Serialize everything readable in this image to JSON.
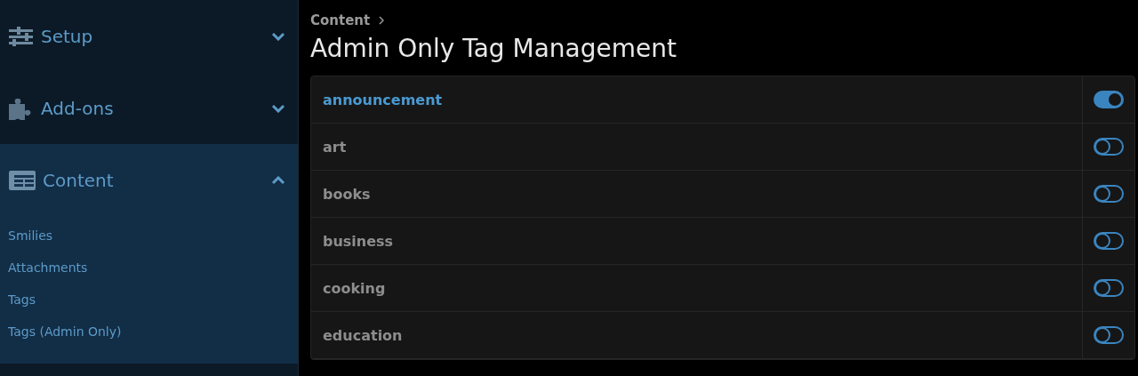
{
  "sidebar": {
    "sections": [
      {
        "label": "Setup",
        "expanded": false
      },
      {
        "label": "Add-ons",
        "expanded": false
      },
      {
        "label": "Content",
        "expanded": true,
        "items": [
          "Smilies",
          "Attachments",
          "Tags",
          "Tags (Admin Only)"
        ]
      }
    ]
  },
  "breadcrumb": [
    "Content"
  ],
  "title": "Admin Only Tag Management",
  "tags": [
    {
      "name": "announcement",
      "on": true
    },
    {
      "name": "art",
      "on": false
    },
    {
      "name": "books",
      "on": false
    },
    {
      "name": "business",
      "on": false
    },
    {
      "name": "cooking",
      "on": false
    },
    {
      "name": "education",
      "on": false
    }
  ]
}
